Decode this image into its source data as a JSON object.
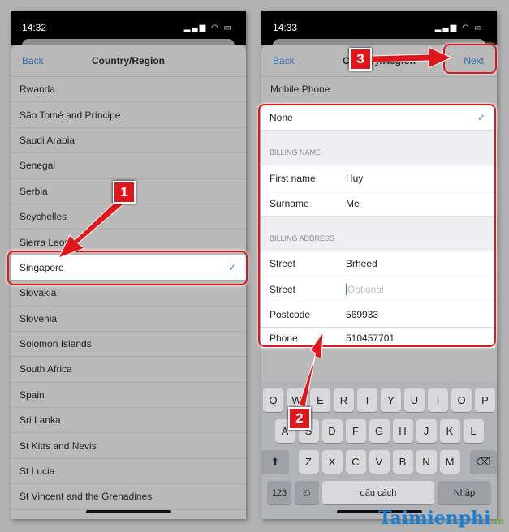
{
  "left": {
    "time": "14:32",
    "nav": {
      "back": "Back",
      "title": "Country/Region"
    },
    "countries": [
      "Rwanda",
      "São Tomé and Príncipe",
      "Saudi Arabia",
      "Senegal",
      "Serbia",
      "Seychelles",
      "Sierra Leone",
      "Singapore",
      "Slovakia",
      "Slovenia",
      "Solomon Islands",
      "South Africa",
      "Spain",
      "Sri Lanka",
      "St Kitts and Nevis",
      "St Lucia",
      "St Vincent and the Grenadines"
    ],
    "selected": "Singapore",
    "check": "✓"
  },
  "right": {
    "time": "14:33",
    "nav": {
      "back": "Back",
      "title": "Country/Region",
      "next": "Next"
    },
    "mobile_phone": "Mobile Phone",
    "none": "None",
    "check": "✓",
    "billing_name_header": "BILLING NAME",
    "first_name_label": "First name",
    "first_name": "Huy",
    "surname_label": "Surname",
    "surname": "Me",
    "billing_address_header": "BILLING ADDRESS",
    "street_label": "Street",
    "street": "Brheed",
    "street2_label": "Street",
    "street2_placeholder": "Optional",
    "postcode_label": "Postcode",
    "postcode": "569933",
    "phone_label": "Phone",
    "phone": "510457701",
    "keyboard": {
      "row1": [
        "Q",
        "W",
        "E",
        "R",
        "T",
        "Y",
        "U",
        "I",
        "O",
        "P"
      ],
      "row2": [
        "A",
        "S",
        "D",
        "F",
        "G",
        "H",
        "J",
        "K",
        "L"
      ],
      "row3": [
        "Z",
        "X",
        "C",
        "V",
        "B",
        "N",
        "M"
      ],
      "num": "123",
      "space": "dấu cách",
      "return": "Nhập"
    }
  },
  "badges": [
    "1",
    "2",
    "3"
  ],
  "watermark": "Taimienphi.vn",
  "colors": {
    "highlight": "#e0161b",
    "link": "#2f6fb5"
  }
}
